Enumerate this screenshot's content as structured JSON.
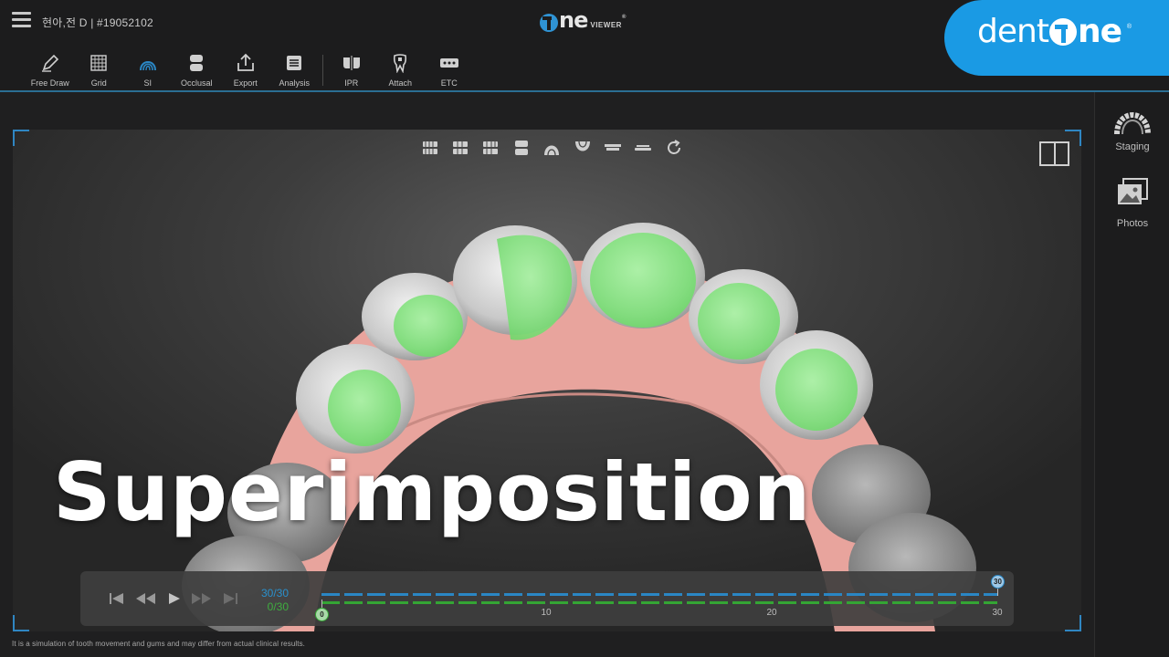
{
  "header": {
    "patient_info": "현아,전 D | #19052102",
    "viewer_logo_text": "ne",
    "viewer_logo_sub": "VIEWER",
    "viewer_logo_reg": "®",
    "brand_text_left": "dent",
    "brand_text_right": "ne",
    "brand_reg": "®",
    "accent_color": "#2b6e93",
    "brand_color": "#1a9ae4"
  },
  "toolbar": {
    "items": [
      {
        "label": "Free Draw",
        "icon": "pencil-icon"
      },
      {
        "label": "Grid",
        "icon": "grid-icon"
      },
      {
        "label": "SI",
        "icon": "superimposition-icon",
        "active": true
      },
      {
        "label": "Occlusal",
        "icon": "occlusal-icon"
      },
      {
        "label": "Export",
        "icon": "export-icon"
      },
      {
        "label": "Analysis",
        "icon": "analysis-icon"
      },
      {
        "label": "IPR",
        "icon": "ipr-icon"
      },
      {
        "label": "Attach",
        "icon": "attach-icon"
      },
      {
        "label": "ETC",
        "icon": "more-icon"
      }
    ]
  },
  "right_panel": {
    "staging_label": "Staging",
    "photos_label": "Photos"
  },
  "viewport": {
    "view_icons": [
      "view-front-icon",
      "view-right-icon",
      "view-left-icon",
      "view-back-icon",
      "view-upper-icon",
      "view-lower-icon",
      "view-bite-icon",
      "view-open-icon",
      "rotate-icon"
    ],
    "overlay_title": "Superimposition"
  },
  "playback": {
    "blue_count": "30/30",
    "green_count": "0/30",
    "start_marker": "0",
    "end_marker": "30",
    "ticks": [
      "10",
      "20",
      "30"
    ],
    "current_step": 30,
    "total_steps": 30
  },
  "footer": {
    "disclaimer": "It is a simulation of tooth movement and gums and may differ from actual clinical results."
  }
}
